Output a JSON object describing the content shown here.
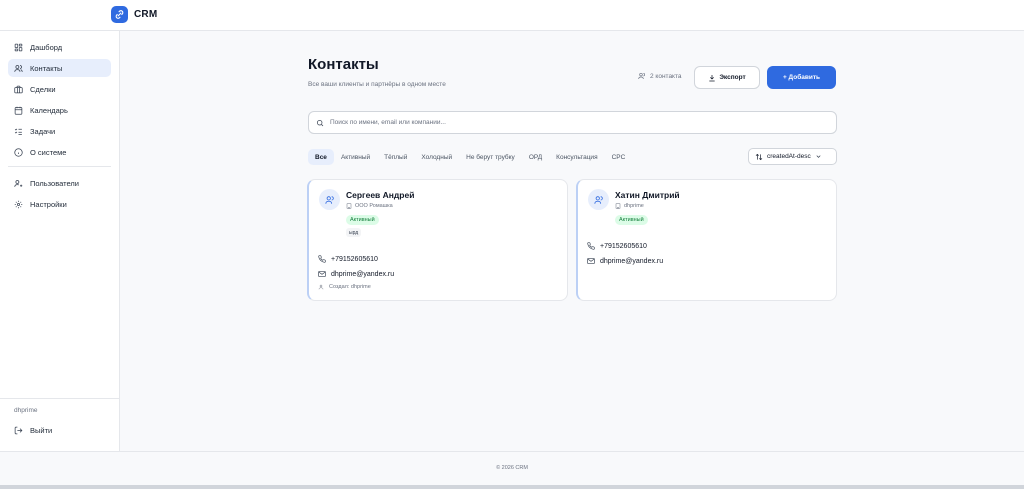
{
  "app": {
    "name": "CRM",
    "brand_color": "#2f6ae0"
  },
  "sidebar": {
    "items": [
      {
        "label": "Дашборд",
        "icon": "dashboard-icon"
      },
      {
        "label": "Контакты",
        "icon": "contacts-icon",
        "active": true
      },
      {
        "label": "Сделки",
        "icon": "deals-icon"
      },
      {
        "label": "Календарь",
        "icon": "calendar-icon"
      },
      {
        "label": "Задачи",
        "icon": "tasks-icon"
      },
      {
        "label": "О системе",
        "icon": "info-icon"
      }
    ],
    "admin_items": [
      {
        "label": "Пользователи",
        "icon": "users-icon"
      },
      {
        "label": "Настройки",
        "icon": "gear-icon"
      }
    ],
    "user": "dhprime",
    "logout_label": "Выйти"
  },
  "header": {
    "title": "Контакты",
    "subtitle": "Все ваши клиенты и партнёры в одном месте",
    "count_label": "2 контакта",
    "export_label": "Экспорт",
    "add_label": "+ Добавить"
  },
  "search": {
    "placeholder": "Поиск по имени, email или компании..."
  },
  "filters": [
    "Все",
    "Активный",
    "Тёплый",
    "Холодный",
    "Не берут трубку",
    "ОРД",
    "Консультация",
    "CPC"
  ],
  "sort": {
    "value": "createdAt-desc"
  },
  "contacts": [
    {
      "name": "Сергеев Андрей",
      "company": "ООО Ромашка",
      "status": "Активный",
      "tag": "ырд",
      "phone": "+79152605610",
      "email": "dhprime@yandex.ru",
      "created_by": "Создал: dhprime"
    },
    {
      "name": "Хатин Дмитрий",
      "company": "dhprime",
      "status": "Активный",
      "phone": "+79152605610",
      "email": "dhprime@yandex.ru"
    }
  ],
  "footer": {
    "text": "© 2026 CRM"
  },
  "colors": {
    "accent": "#2f6ae0",
    "active_bg": "#e7eefc",
    "status_green": "#15803d"
  }
}
